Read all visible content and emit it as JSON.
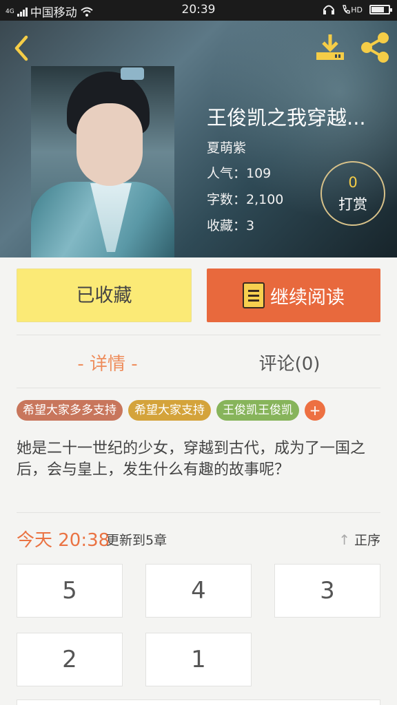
{
  "status_bar": {
    "carrier": "中国移动",
    "time": "20:39",
    "network": "4G",
    "hd": "HD"
  },
  "book": {
    "title": "王俊凯之我穿越...",
    "author": "夏萌紫",
    "popularity": "人气：109",
    "word_count": "字数：2,100",
    "favorites": "收藏：3"
  },
  "reward": {
    "count": "0",
    "label": "打赏"
  },
  "actions": {
    "favorited_label": "已收藏",
    "continue_label": "继续阅读"
  },
  "tabs": [
    {
      "label": "- 详情 -",
      "active": true
    },
    {
      "label": "评论(0)",
      "active": false
    }
  ],
  "tags": [
    {
      "label": "希望大家多多支持",
      "color": "#c8765c"
    },
    {
      "label": "希望大家支持",
      "color": "#d4a33b"
    },
    {
      "label": "王俊凯王俊凯",
      "color": "#87b45b"
    }
  ],
  "add_tag_label": "+",
  "description": "她是二十一世纪的少女，穿越到古代，成为了一国之后，会与皇上，发生什么有趣的故事呢？",
  "update": {
    "today": "今天 20:38",
    "text": "更新到5章",
    "sort_label": "正序"
  },
  "chapters": [
    "5",
    "4",
    "3",
    "2",
    "1"
  ],
  "colors": {
    "accent": "#e8693d",
    "favorite_btn": "#fbea76",
    "icon_yellow": "#f5cd47"
  }
}
